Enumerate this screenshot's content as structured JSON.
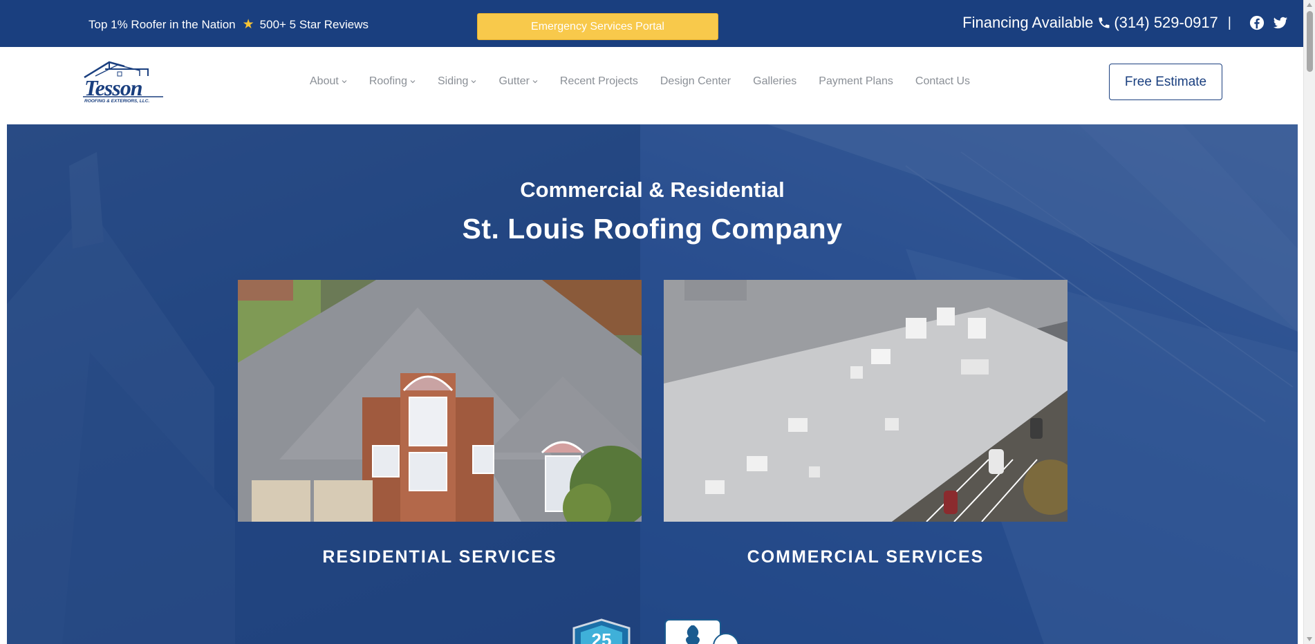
{
  "topbar": {
    "tagline": "Top 1% Roofer in the Nation",
    "reviews": "500+ 5 Star Reviews",
    "emergency_button": "Emergency Services Portal",
    "financing": "Financing Available",
    "phone": "(314) 529-0917",
    "separator": "|",
    "icons": [
      "star-icon",
      "phone-icon",
      "facebook-icon",
      "twitter-icon"
    ]
  },
  "header": {
    "logo_text": "Tesson",
    "logo_subtext": "ROOFING & EXTERIORS, LLC.",
    "nav": [
      {
        "label": "About",
        "has_dropdown": true
      },
      {
        "label": "Roofing",
        "has_dropdown": true
      },
      {
        "label": "Siding",
        "has_dropdown": true
      },
      {
        "label": "Gutter",
        "has_dropdown": true
      },
      {
        "label": "Recent Projects",
        "has_dropdown": false
      },
      {
        "label": "Design Center",
        "has_dropdown": false
      },
      {
        "label": "Galleries",
        "has_dropdown": false
      },
      {
        "label": "Payment Plans",
        "has_dropdown": false
      },
      {
        "label": "Contact Us",
        "has_dropdown": false
      }
    ],
    "cta": "Free Estimate"
  },
  "hero": {
    "subtitle": "Commercial & Residential",
    "title": "St. Louis Roofing Company",
    "cards": [
      {
        "label": "RESIDENTIAL SERVICES",
        "image": "aerial view of brick house roof"
      },
      {
        "label": "COMMERCIAL SERVICES",
        "image": "aerial view of flat commercial roof"
      }
    ],
    "badges": [
      "25-year-badge",
      "bbb-badge"
    ]
  },
  "colors": {
    "brand_blue": "#1a3f7f",
    "accent_yellow": "#f8c94b",
    "nav_gray": "#8a8f96"
  }
}
